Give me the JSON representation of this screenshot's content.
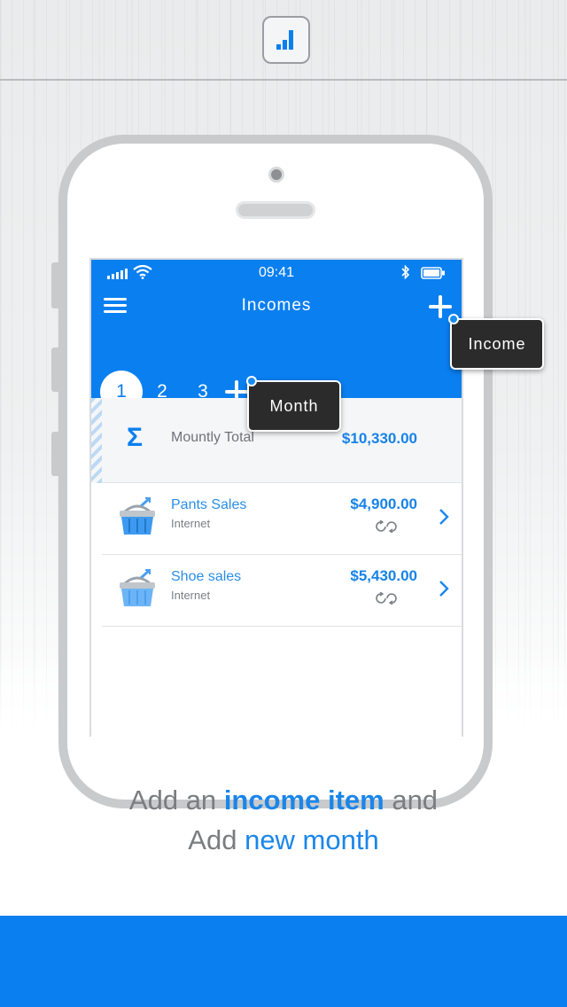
{
  "colors": {
    "brand_blue": "#0a7ff0",
    "link_blue": "#2b8de6",
    "tooltip_bg": "#2b2b2b"
  },
  "status_bar": {
    "time": "09:41"
  },
  "header": {
    "title": "Incomes",
    "menu_icon": "hamburger-icon",
    "add_icon": "plus-icon"
  },
  "months": {
    "tabs": [
      "1",
      "2",
      "3"
    ],
    "active_index": 0
  },
  "summary": {
    "label": "Mountly Total",
    "amount": "$10,330.00",
    "icon": "sigma-icon"
  },
  "items": [
    {
      "name": "Pants Sales",
      "category": "Internet",
      "amount": "$4,900.00",
      "icon": "basket-icon",
      "recurring": true
    },
    {
      "name": "Shoe sales",
      "category": "Internet",
      "amount": "$5,430.00",
      "icon": "basket-icon",
      "recurring": true
    }
  ],
  "tooltips": {
    "income": "Income",
    "month": "Month"
  },
  "caption": {
    "line1_prefix": "Add an",
    "line1_highlight": "income item",
    "line1_suffix": "and",
    "line2_prefix": "Add",
    "line2_highlight": "new month"
  }
}
